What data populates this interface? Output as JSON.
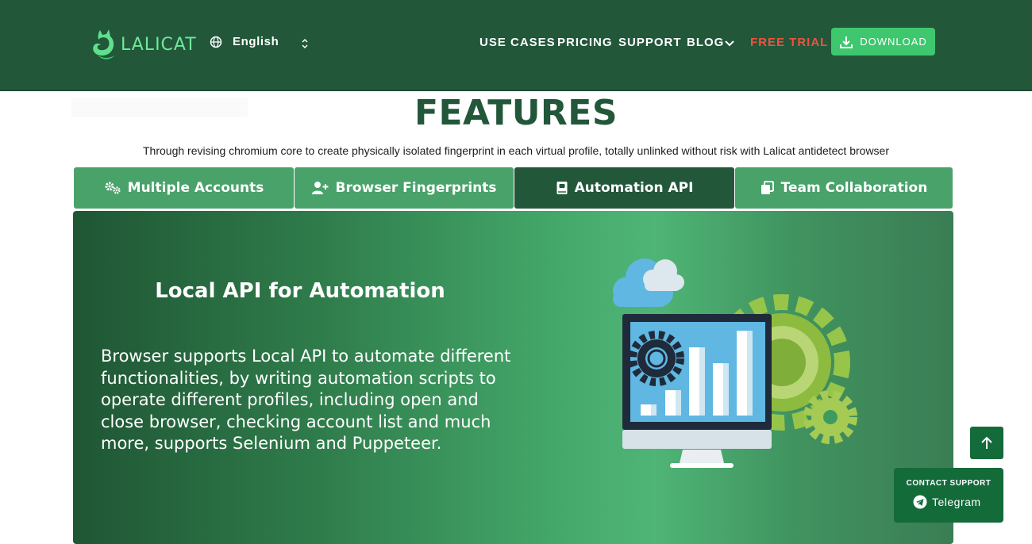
{
  "header": {
    "logo_text": "LALICAT",
    "language": "English",
    "nav": [
      "USE CASES",
      "PRICING",
      "SUPPORT",
      "BLOG"
    ],
    "free_trial": "FREE TRIAL",
    "download": "DOWNLOAD"
  },
  "features": {
    "title": "FEATURES",
    "subtitle": "Through revising chromium core to create physically isolated fingerprint in each virtual profile, totally unlinked without risk with Lalicat antidetect browser"
  },
  "tabs": [
    {
      "label": "Multiple Accounts",
      "icon": "gears-icon",
      "active": false
    },
    {
      "label": "Browser Fingerprints",
      "icon": "user-plus-icon",
      "active": false
    },
    {
      "label": "Automation API",
      "icon": "book-icon",
      "active": true
    },
    {
      "label": "Team Collaboration",
      "icon": "copy-icon",
      "active": false
    }
  ],
  "panel": {
    "title": "Local API for Automation",
    "description": "Browser supports Local API to automate different functionalities, by writing automation scripts to operate different profiles, including open and close browser, checking account list and much more, supports Selenium and Puppeteer."
  },
  "contact": {
    "label": "CONTACT SUPPORT",
    "channel": "Telegram"
  },
  "colors": {
    "header_bg": "#22573a",
    "accent_green": "#3ec76e",
    "tab_bg": "#49a26a",
    "tab_active_bg": "#22573a",
    "free_trial": "#f0523f",
    "support_bg": "#146b3a"
  }
}
